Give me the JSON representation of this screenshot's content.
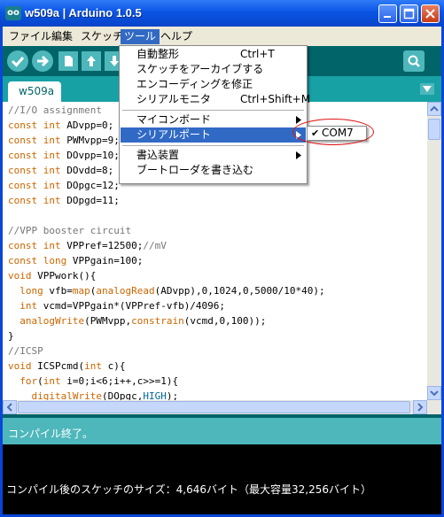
{
  "window": {
    "title": "w509a | Arduino 1.0.5",
    "app_icon": "oo"
  },
  "menubar": [
    {
      "label": "ファイル"
    },
    {
      "label": "編集"
    },
    {
      "label": "スケッチ"
    },
    {
      "label": "ツール",
      "active": true
    },
    {
      "label": "ヘルプ"
    }
  ],
  "tools_menu": {
    "items": [
      {
        "label": "自動整形",
        "shortcut": "Ctrl+T"
      },
      {
        "label": "スケッチをアーカイブする",
        "shortcut": ""
      },
      {
        "label": "エンコーディングを修正",
        "shortcut": ""
      },
      {
        "label": "シリアルモニタ",
        "shortcut": "Ctrl+Shift+M"
      },
      {
        "label": "マイコンボード",
        "shortcut": ""
      },
      {
        "label": "シリアルポート",
        "shortcut": "",
        "highlighted": true
      },
      {
        "label": "書込装置",
        "shortcut": ""
      },
      {
        "label": "ブートローダを書き込む",
        "shortcut": ""
      }
    ]
  },
  "serial_port_submenu": {
    "check": "✔",
    "selected_port": "COM7"
  },
  "tab": {
    "label": "w509a"
  },
  "code": [
    "//I/O assignment",
    "const int ADvpp=0;",
    "const int PWMvpp=9;",
    "const int DOvpp=10;",
    "const int DOvdd=8;",
    "const int DOpgc=12;",
    "const int DOpgd=11;",
    "",
    "//VPP booster circuit",
    "const int VPPref=12500;//mV",
    "const long VPPgain=100;",
    "void VPPwork(){",
    "  long vfb=map(analogRead(ADvpp),0,1024,0,5000/10*40);",
    "  int vcmd=VPPgain*(VPPref-vfb)/4096;",
    "  analogWrite(PWMvpp,constrain(vcmd,0,100));",
    "}",
    "//ICSP",
    "void ICSPcmd(int c){",
    "  for(int i=0;i<6;i++,c>>=1){",
    "    digitalWrite(DOpgc,HIGH);"
  ],
  "status": {
    "message": "コンパイル終了。"
  },
  "console": {
    "output": "コンパイル後のスケッチのサイズ：4,646バイト（最大容量32,256バイト）"
  },
  "colors": {
    "arduino_teal_dark": "#006468",
    "arduino_teal_mid": "#17a1a5",
    "arduino_teal_light": "#4db7bb",
    "menu_highlight": "#316ac5",
    "annotation_red": "#e01010"
  }
}
